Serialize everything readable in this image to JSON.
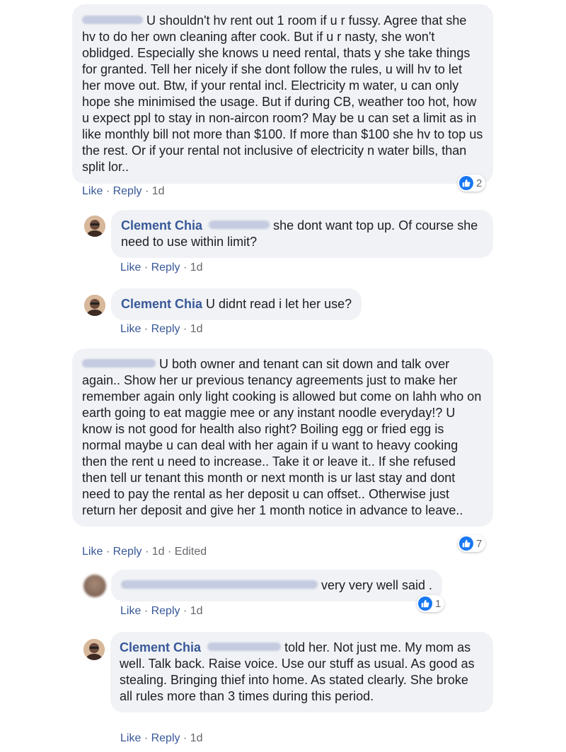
{
  "thread": {
    "c1": {
      "text": "U shouldn't hv rent out 1 room if u r fussy. Agree that she hv to do her own cleaning after cook. But if u r nasty, she won't oblidged. Especially she knows u need rental, thats y she take things for granted. Tell her nicely if she dont follow the rules, u will hv to let her move out. Btw, if your rental incl. Electricity m water, u can only hope she minimised the usage. But if during CB, weather too hot, how u expect ppl to stay in non-aircon room? May be u can set a limit as in like monthly bill not more than $100. If more than $100 she hv to top us the rest. Or if your rental not inclusive of electricity n water bills, than split lor..",
      "like": "Like",
      "reply": "Reply",
      "time": "1d",
      "reactions": "2"
    },
    "r1": {
      "author": "Clement Chia",
      "text": "she dont want top up. Of course she need to use within limit?",
      "like": "Like",
      "reply": "Reply",
      "time": "1d"
    },
    "r2": {
      "author": "Clement Chia",
      "text": "U didnt read i let her use?",
      "like": "Like",
      "reply": "Reply",
      "time": "1d"
    },
    "c2": {
      "text": "U both owner and tenant can sit down and talk over again.. Show her ur previous tenancy agreements just to make her remember again only light cooking is allowed but come on lahh who on earth going to eat maggie mee or any instant noodle everyday!? U know is not good for health also right? Boiling egg or fried egg is normal maybe u can deal with her again if u want to heavy cooking then the rent u need to increase.. Take it or leave it.. If she refused then tell ur tenant this month or next month is ur last stay and dont need to pay the rental as her deposit u can offset.. Otherwise just return her deposit and give her 1 month notice in advance to leave..",
      "like": "Like",
      "reply": "Reply",
      "time": "1d",
      "edited": "Edited",
      "reactions": "7"
    },
    "r3": {
      "text": "very very well said .",
      "like": "Like",
      "reply": "Reply",
      "time": "1d",
      "reactions": "1"
    },
    "r4": {
      "author": "Clement Chia",
      "text": "told her. Not just me. My mom as well. Talk back. Raise voice. Use our stuff as usual. As good as stealing. Bringing thief into home. As stated clearly. She broke all rules more than 3 times during this period.",
      "like": "Like",
      "reply": "Reply",
      "time": "1d"
    }
  },
  "icons": {
    "reaction": "like-thumb-icon"
  },
  "colors": {
    "bubble": "#f0f2f5",
    "author": "#385898",
    "meta": "#65676b",
    "like_icon": "#1877f2"
  }
}
